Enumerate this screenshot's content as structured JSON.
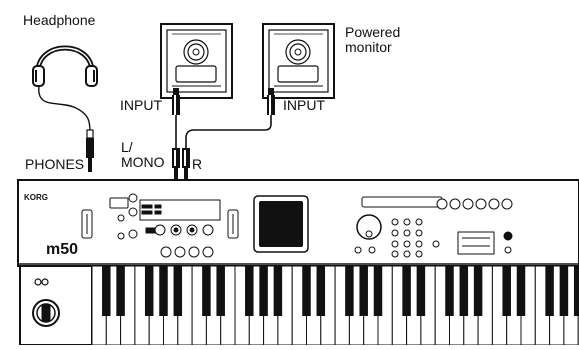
{
  "labels": {
    "headphone": "Headphone",
    "powered_monitor": "Powered\nmonitor",
    "input_left": "INPUT",
    "input_right": "INPUT",
    "phones": "PHONES",
    "l_mono": "L/\nMONO",
    "r": "R"
  },
  "keyboard": {
    "brand": "KORG",
    "model": "m50"
  }
}
